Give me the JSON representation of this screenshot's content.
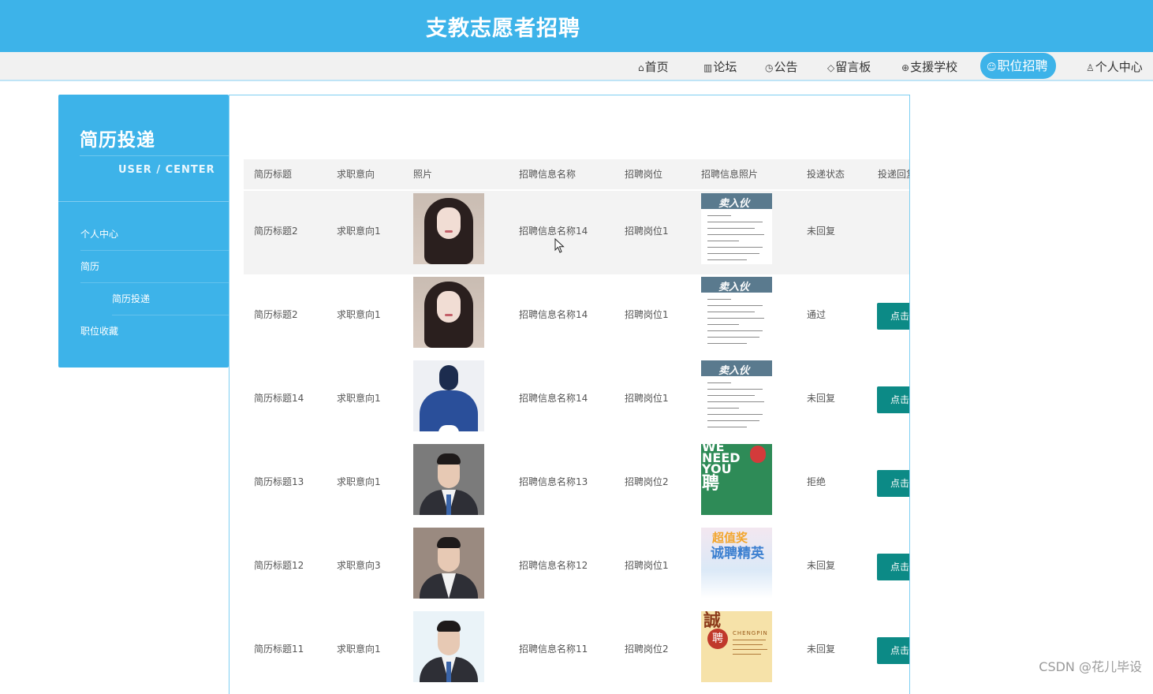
{
  "header": {
    "title": "支教志愿者招聘"
  },
  "nav": {
    "items": [
      {
        "label": "首页",
        "icon": "home-icon",
        "glyph": "⌂"
      },
      {
        "label": "论坛",
        "icon": "forum-icon",
        "glyph": "▥"
      },
      {
        "label": "公告",
        "icon": "announcement-icon",
        "glyph": "◷"
      },
      {
        "label": "留言板",
        "icon": "tag-icon",
        "glyph": "◇"
      },
      {
        "label": "支援学校",
        "icon": "globe-icon",
        "glyph": "⊕"
      },
      {
        "label": "职位招聘",
        "icon": "smile-icon",
        "glyph": "☺",
        "active": true
      },
      {
        "label": "个人中心",
        "icon": "user-icon",
        "glyph": "♙"
      }
    ]
  },
  "sidebar": {
    "title": "简历投递",
    "subtitle": "USER / CENTER",
    "menu": [
      {
        "label": "个人中心"
      },
      {
        "label": "简历"
      },
      {
        "label": "简历投递"
      },
      {
        "label": "职位收藏"
      }
    ]
  },
  "table": {
    "headers": [
      "简历标题",
      "求职意向",
      "照片",
      "招聘信息名称",
      "招聘岗位",
      "招聘信息照片",
      "投递状态",
      "投递回复"
    ],
    "rows": [
      {
        "title": "简历标题2",
        "intent": "求职意向1",
        "name": "招聘信息名称14",
        "post": "招聘岗位1",
        "status": "未回复",
        "button": ""
      },
      {
        "title": "简历标题2",
        "intent": "求职意向1",
        "name": "招聘信息名称14",
        "post": "招聘岗位1",
        "status": "通过",
        "button": "点击"
      },
      {
        "title": "简历标题14",
        "intent": "求职意向1",
        "name": "招聘信息名称14",
        "post": "招聘岗位1",
        "status": "未回复",
        "button": "点击"
      },
      {
        "title": "简历标题13",
        "intent": "求职意向1",
        "name": "招聘信息名称13",
        "post": "招聘岗位2",
        "status": "拒绝",
        "button": "点击"
      },
      {
        "title": "简历标题12",
        "intent": "求职意向3",
        "name": "招聘信息名称12",
        "post": "招聘岗位1",
        "status": "未回复",
        "button": "点击"
      },
      {
        "title": "简历标题11",
        "intent": "求职意向1",
        "name": "招聘信息名称11",
        "post": "招聘岗位2",
        "status": "未回复",
        "button": "点击"
      }
    ]
  },
  "posters": {
    "doc_title": "卖入伙",
    "green_lines": [
      "WE",
      "NEED",
      "YOU",
      "聘"
    ],
    "pastel_top": "超值奖",
    "pastel_main": "诚聘精英",
    "gold_big": "誠",
    "gold_seal": "聘",
    "gold_sub": "CHENGPIN"
  },
  "watermark": "CSDN @花儿毕设",
  "colors": {
    "primary": "#3db3e9",
    "button": "#0c8a86",
    "header_bg": "#f3f3f3"
  }
}
